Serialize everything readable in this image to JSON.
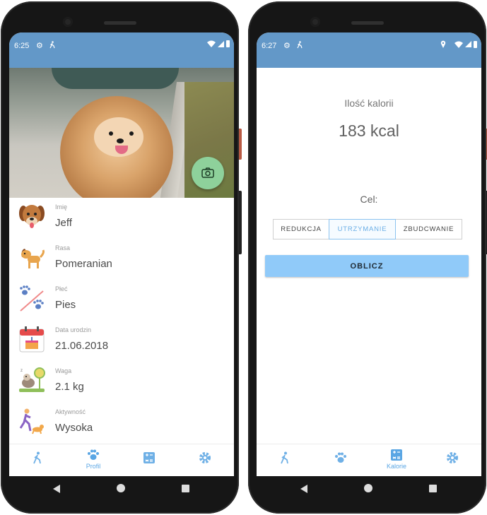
{
  "left_phone": {
    "status": {
      "time": "6:25"
    },
    "profile": {
      "fields": [
        {
          "label": "Imię",
          "value": "Jeff",
          "icon": "dog-face-icon"
        },
        {
          "label": "Rasa",
          "value": "Pomeranian",
          "icon": "dog-breed-icon"
        },
        {
          "label": "Płeć",
          "value": "Pies",
          "icon": "paw-prints-icon"
        },
        {
          "label": "Data urodzin",
          "value": "21.06.2018",
          "icon": "birthday-calendar-icon"
        },
        {
          "label": "Waga",
          "value": "2.1 kg",
          "icon": "dog-scale-icon"
        },
        {
          "label": "Aktywność",
          "value": "Wysoka",
          "icon": "running-with-dog-icon"
        }
      ]
    },
    "nav": {
      "profil_label": "Profil",
      "active": "profil"
    }
  },
  "right_phone": {
    "status": {
      "time": "6:27"
    },
    "calories": {
      "title": "Ilość kalorii",
      "value": "183 kcal",
      "goal_title": "Cel:",
      "options": [
        "REDUKCJA",
        "UTRZYMANIE",
        "ZBUDCWANIE"
      ],
      "selected": "UTRZYMANIE",
      "button_label": "OBLICZ"
    },
    "nav": {
      "kalorie_label": "Kalorie",
      "active": "kalorie"
    }
  },
  "colors": {
    "statusbar": "#6398c8",
    "accent": "#5aa6e4",
    "button": "#90caf9",
    "fab": "#8ed19b"
  }
}
